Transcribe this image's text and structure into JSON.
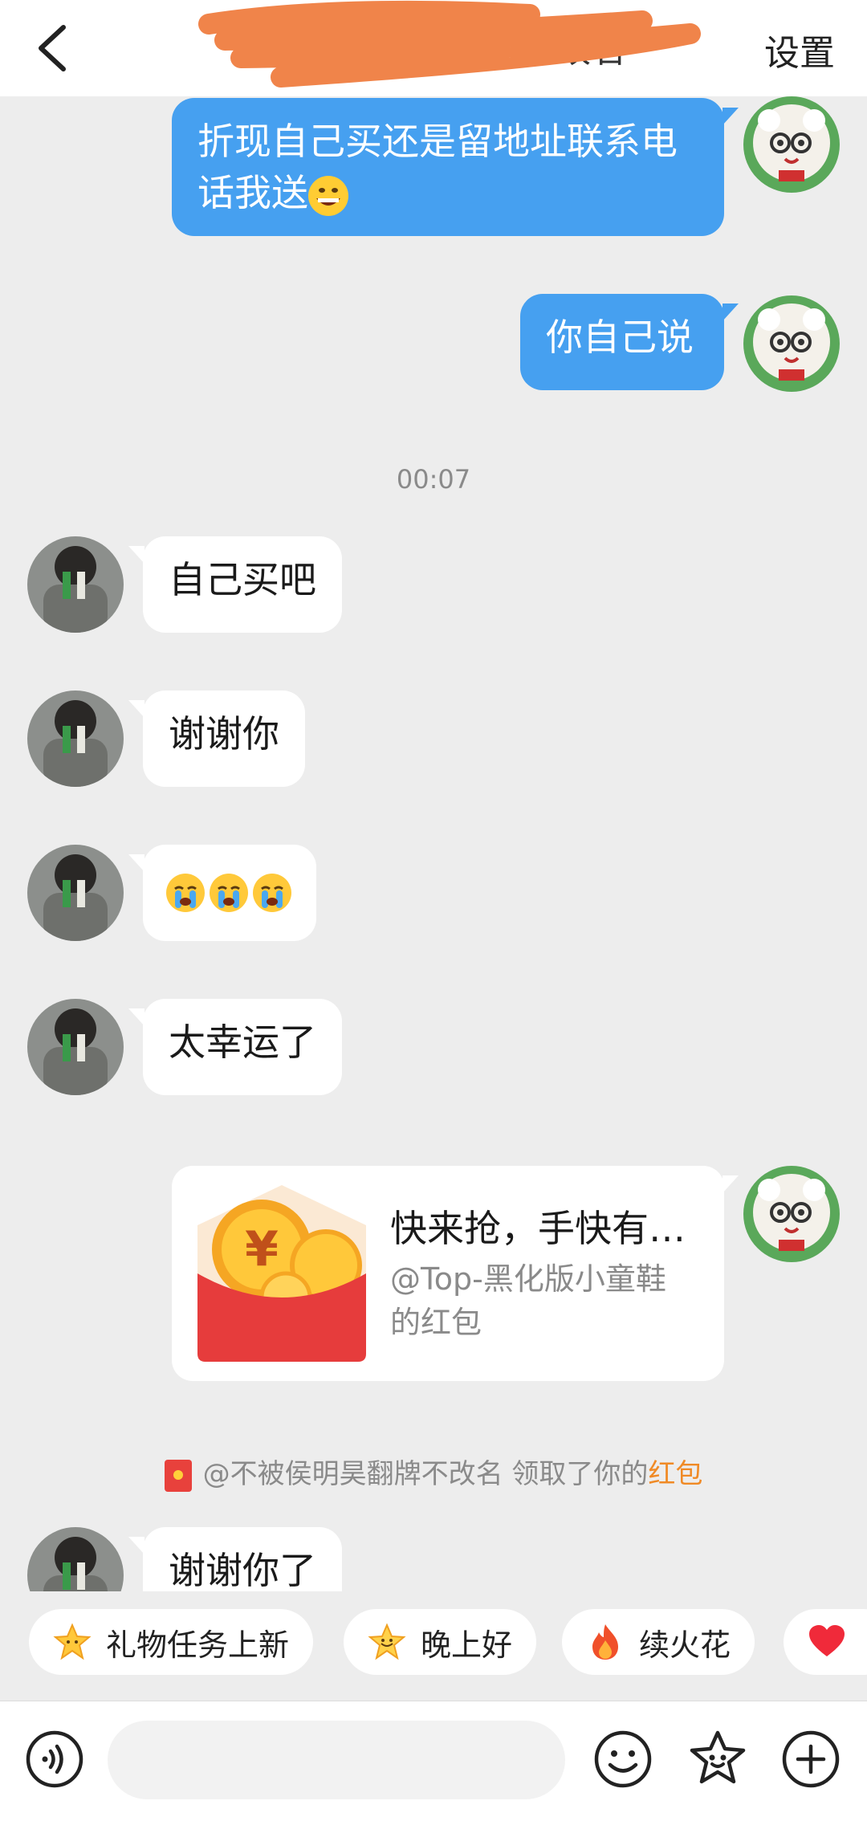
{
  "header": {
    "title": "不被侯明昊翻牌不改名",
    "settings_label": "设置"
  },
  "messages": [
    {
      "side": "out",
      "text": "折现自己买还是留地址联系电话我送"
    },
    {
      "side": "out",
      "text": "你自己说"
    },
    {
      "side": "in",
      "text": "自己买吧"
    },
    {
      "side": "in",
      "text": "谢谢你"
    },
    {
      "side": "in",
      "text": ""
    },
    {
      "side": "in",
      "text": "太幸运了"
    },
    {
      "side": "in",
      "text": "谢谢你了"
    }
  ],
  "timestamp": "00:07",
  "red_packet": {
    "title": "快来抢，手快有…",
    "sender": "@Top-黑化版小童鞋的红包"
  },
  "notice": {
    "prefix": "@不被侯明昊翻牌不改名 领取了你的",
    "link": "红包"
  },
  "chips": [
    {
      "label": "礼物任务上新",
      "icon": "star-icon"
    },
    {
      "label": "晚上好",
      "icon": "star-face-icon"
    },
    {
      "label": "续火花",
      "icon": "fire-icon"
    },
    {
      "label": "",
      "icon": "heart-icon"
    }
  ],
  "input": {
    "placeholder": ""
  },
  "colors": {
    "outgoing_bubble": "#46a0f0",
    "background": "#ededed",
    "highlight": "#f08a25"
  }
}
